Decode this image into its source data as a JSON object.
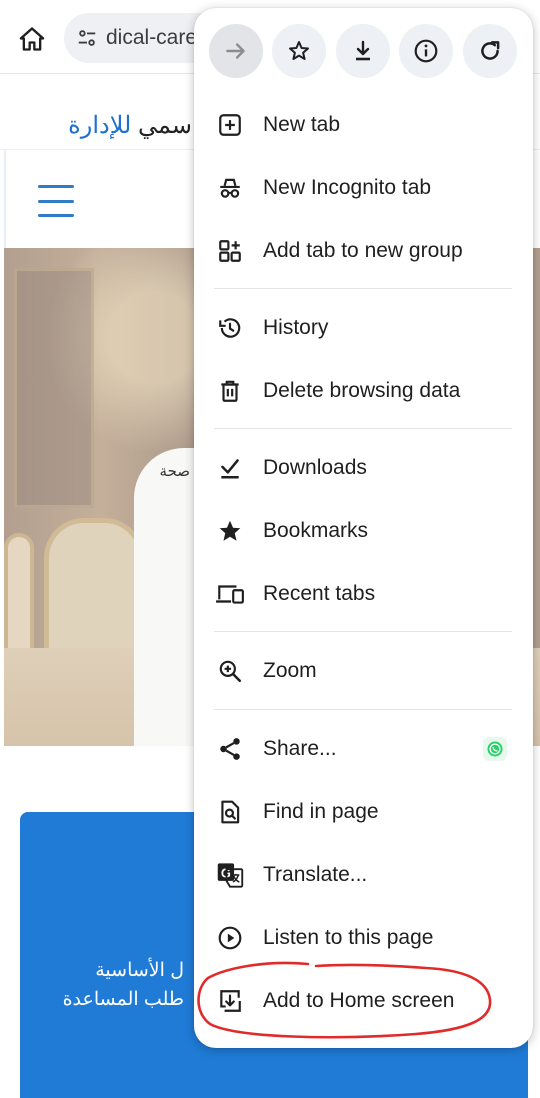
{
  "browser": {
    "url_text": "dical-care",
    "home_icon": "home-icon",
    "site_info_icon": "tune-icon"
  },
  "page": {
    "hero_title_blue": "للإدارة",
    "hero_title_dark": "سمي",
    "hero_subtitle": "صحة",
    "card_line_1": "ل الأساسية",
    "card_line_2": "طلب المساعدة",
    "accent_color": "#1f7bd6"
  },
  "menu": {
    "toolbar": [
      {
        "name": "forward",
        "icon": "arrow-forward-icon"
      },
      {
        "name": "bookmark",
        "icon": "star-outline-icon"
      },
      {
        "name": "download",
        "icon": "download-icon"
      },
      {
        "name": "page-info",
        "icon": "info-icon"
      },
      {
        "name": "reload",
        "icon": "refresh-icon"
      }
    ],
    "items": [
      {
        "label": "New tab",
        "icon": "plus-box-icon"
      },
      {
        "label": "New Incognito tab",
        "icon": "incognito-icon"
      },
      {
        "label": "Add tab to new group",
        "icon": "tab-group-icon"
      },
      {
        "label": "History",
        "icon": "history-icon"
      },
      {
        "label": "Delete browsing data",
        "icon": "trash-icon"
      },
      {
        "label": "Downloads",
        "icon": "downloads-check-icon"
      },
      {
        "label": "Bookmarks",
        "icon": "star-filled-icon"
      },
      {
        "label": "Recent tabs",
        "icon": "devices-icon"
      },
      {
        "label": "Zoom",
        "icon": "zoom-icon"
      },
      {
        "label": "Share...",
        "icon": "share-icon"
      },
      {
        "label": "Find in page",
        "icon": "find-page-icon"
      },
      {
        "label": "Translate...",
        "icon": "translate-icon"
      },
      {
        "label": "Listen to this page",
        "icon": "play-circle-icon"
      },
      {
        "label": "Add to Home screen",
        "icon": "add-home-screen-icon"
      }
    ],
    "share_badge_icon": "whatsapp-icon",
    "annotation_color": "#e02b2b"
  }
}
